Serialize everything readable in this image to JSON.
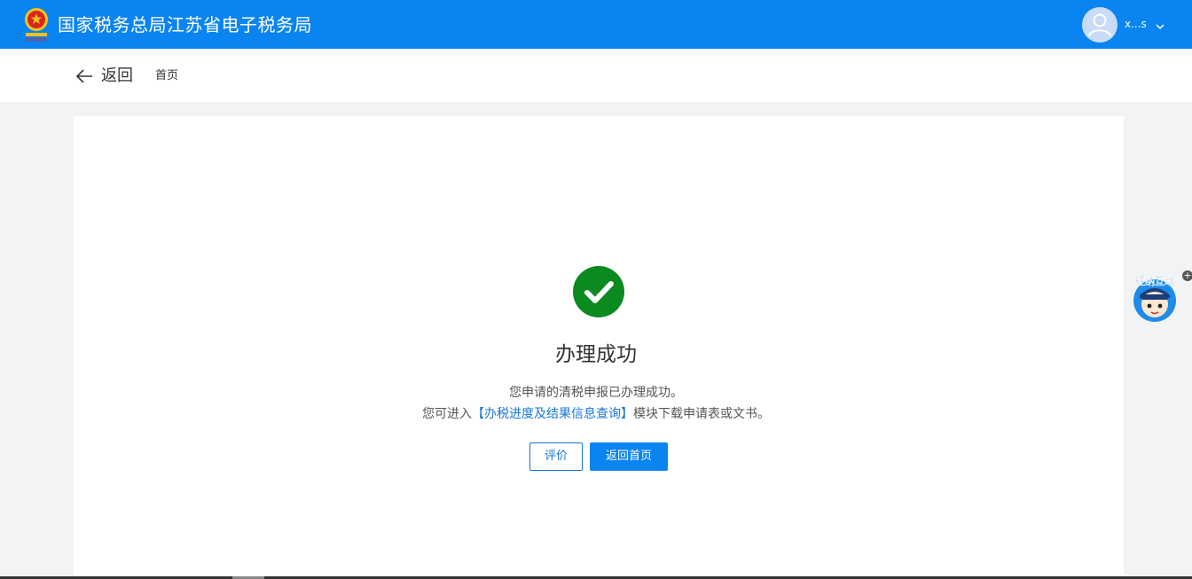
{
  "header": {
    "title": "国家税务总局江苏省电子税务局",
    "user_name": "x...s",
    "logo_icon": "national-tax-emblem",
    "avatar_icon": "user-icon",
    "dropdown_icon": "chevron-down-icon",
    "bar_color": "#0a84f0"
  },
  "subnav": {
    "back_label": "返回",
    "breadcrumb": "首页"
  },
  "result": {
    "status_icon": "check-circle-icon",
    "status_color": "#0a8a1f",
    "title": "办理成功",
    "message_line1": "您申请的清税申报已办理成功。",
    "message_line2_prefix": "您可进入",
    "message_line2_link": "【办税进度及结果信息查询】",
    "message_line2_suffix": "模块下载申请表或文书。"
  },
  "actions": {
    "rate_label": "评价",
    "home_label": "返回首页"
  },
  "assistant": {
    "badge_text": "征纳互动",
    "icon": "tax-officer-avatar-icon",
    "expand_icon": "plus-icon",
    "expand_label": "+"
  }
}
